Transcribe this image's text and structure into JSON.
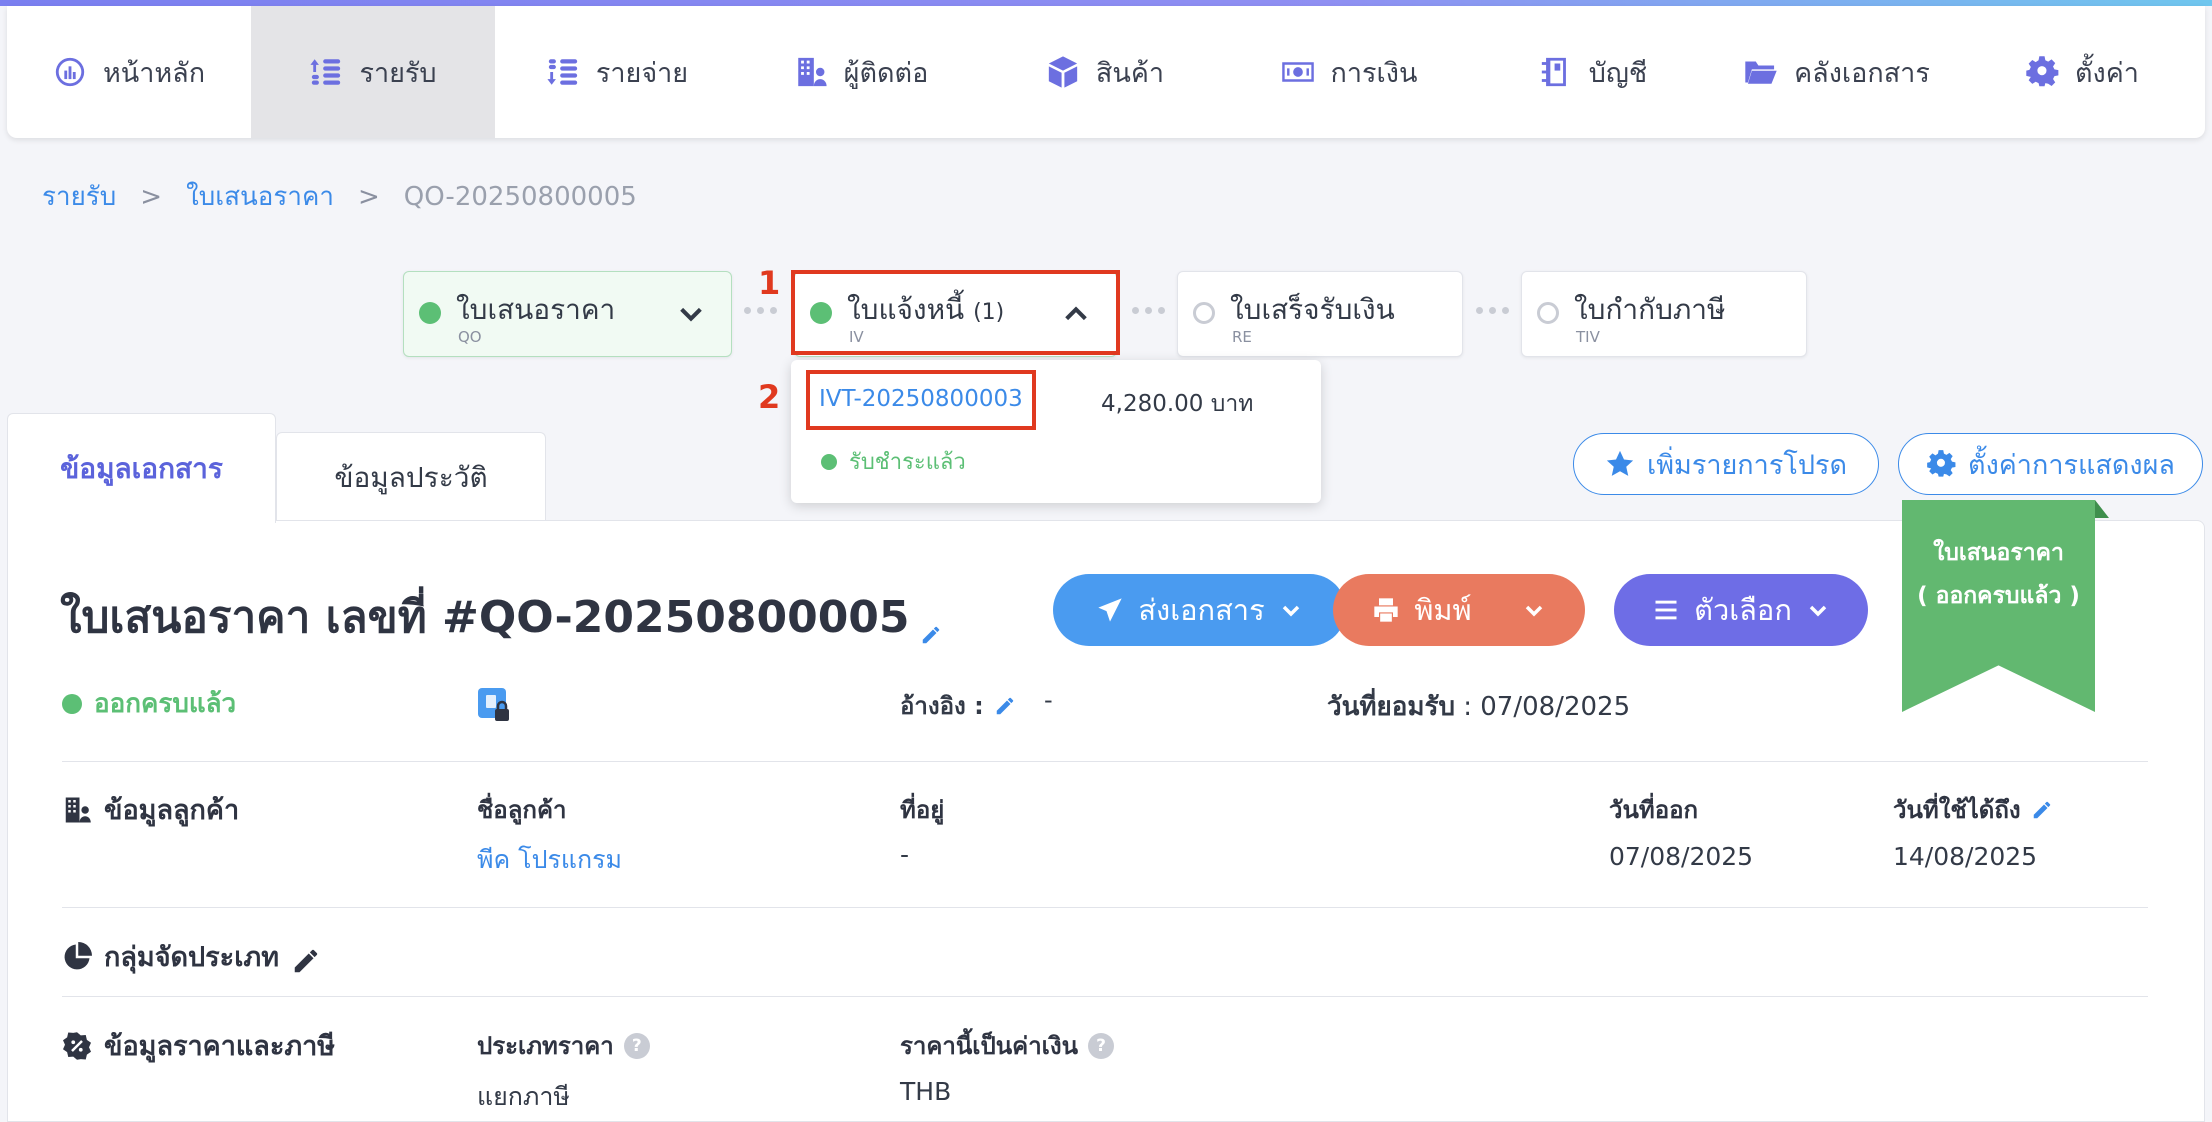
{
  "nav": {
    "items": [
      {
        "label": "หน้าหลัก",
        "icon": "dashboard-icon"
      },
      {
        "label": "รายรับ",
        "icon": "income-icon"
      },
      {
        "label": "รายจ่าย",
        "icon": "expense-icon"
      },
      {
        "label": "ผู้ติดต่อ",
        "icon": "contacts-icon"
      },
      {
        "label": "สินค้า",
        "icon": "product-box-icon"
      },
      {
        "label": "การเงิน",
        "icon": "money-icon"
      },
      {
        "label": "บัญชี",
        "icon": "ledger-book-icon"
      },
      {
        "label": "คลังเอกสาร",
        "icon": "folder-icon"
      },
      {
        "label": "ตั้งค่า",
        "icon": "gear-icon"
      }
    ],
    "active_index": 1
  },
  "breadcrumb": {
    "level1": "รายรับ",
    "sep": ">",
    "level2": "ใบเสนอราคา",
    "current": "QO-20250800005"
  },
  "workflow": {
    "steps": [
      {
        "title": "ใบเสนอราคา",
        "code": "QO",
        "status": "done"
      },
      {
        "title": "ใบแจ้งหนี้",
        "count": "(1)",
        "code": "IV",
        "status": "done"
      },
      {
        "title": "ใบเสร็จรับเงิน",
        "code": "RE",
        "status": "pending"
      },
      {
        "title": "ใบกำกับภาษี",
        "code": "TIV",
        "status": "pending"
      }
    ],
    "markers": [
      "1",
      "2"
    ],
    "dropdown": {
      "doc_no": "IVT-20250800003",
      "amount": "4,280.00 บาท",
      "status": "รับชำระแล้ว"
    }
  },
  "tabs": [
    "ข้อมูลเอกสาร",
    "ข้อมูลประวัติ"
  ],
  "actions": {
    "favorite": "เพิ่มรายการโปรด",
    "display_settings": "ตั้งค่าการแสดงผล",
    "send": "ส่งเอกสาร",
    "print": "พิมพ์",
    "options": "ตัวเลือก"
  },
  "document": {
    "title": "ใบเสนอราคา เลขที่ #QO-20250800005",
    "status": "ออกครบแล้ว",
    "ribbon_line1": "ใบเสนอราคา",
    "ribbon_line2": "( ออกครบแล้ว )",
    "reference_label": "อ้างอิง :",
    "reference_value": "-",
    "accepted_label": "วันที่ยอมรับ",
    "accepted_value": " : 07/08/2025"
  },
  "customer": {
    "heading": "ข้อมูลลูกค้า",
    "name_label": "ชื่อลูกค้า",
    "name_value": "พีค โปรแกรม",
    "address_label": "ที่อยู่",
    "address_value": "-",
    "issue_label": "วันที่ออก",
    "issue_value": "07/08/2025",
    "valid_label": "วันที่ใช้ได้ถึง",
    "valid_value": "14/08/2025"
  },
  "category": {
    "heading": "กลุ่มจัดประเภท"
  },
  "pricing": {
    "heading": "ข้อมูลราคาและภาษี",
    "price_type_label": "ประเภทราคา",
    "price_type_value": "แยกภาษี",
    "currency_label": "ราคานี้เป็นค่าเงิน",
    "currency_value": "THB"
  },
  "colors": {
    "accent": "#6c6fe0",
    "link": "#3b8ae8",
    "success": "#5cbf75",
    "print": "#e97a5f",
    "options": "#6e6de6",
    "highlight": "#e0391f"
  }
}
